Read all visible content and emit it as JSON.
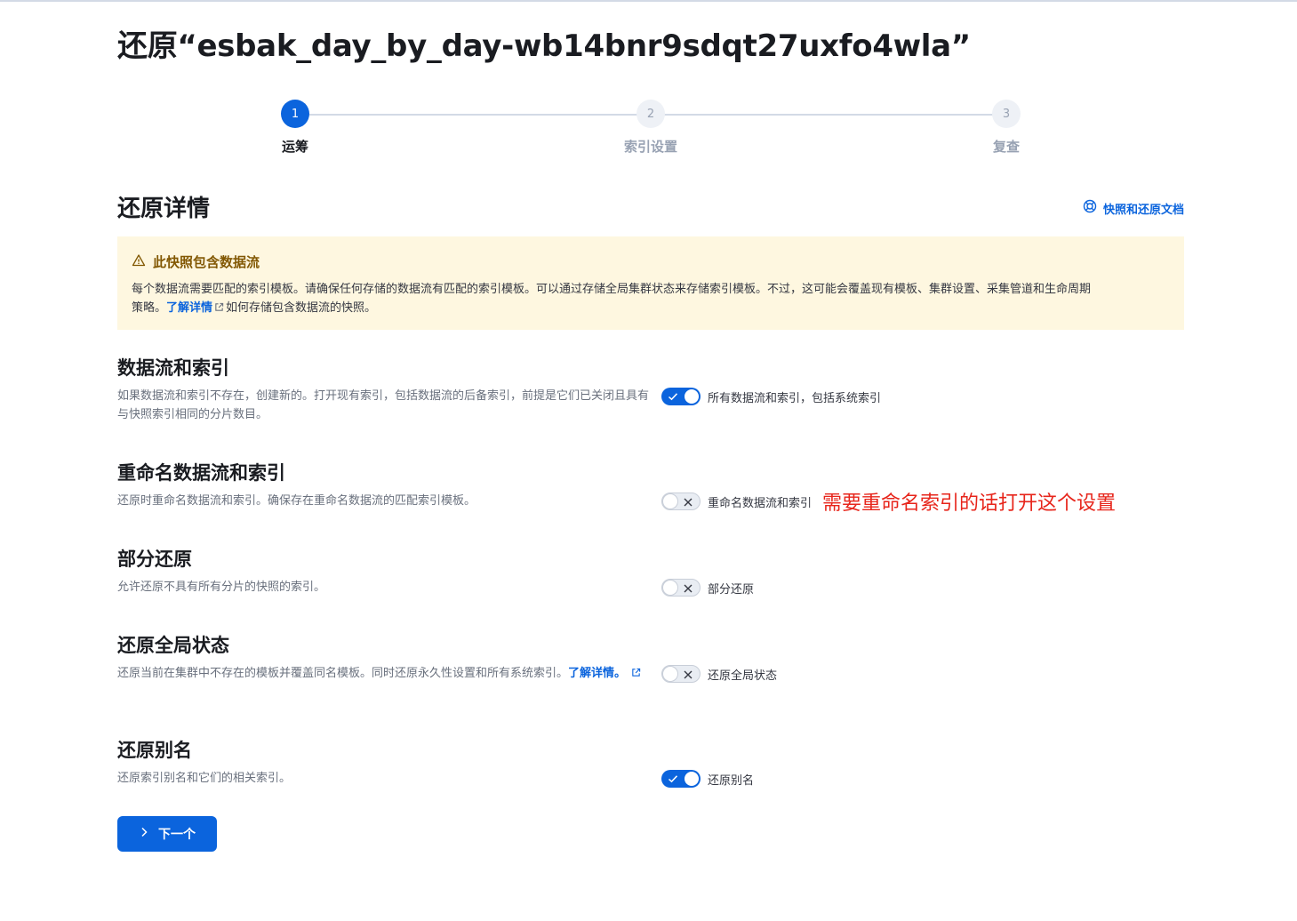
{
  "page": {
    "title": "还原“esbak_day_by_day-wb14bnr9sdqt27uxfo4wla”"
  },
  "stepper": {
    "steps": [
      {
        "number": "1",
        "label": "运筹",
        "state": "active"
      },
      {
        "number": "2",
        "label": "索引设置",
        "state": "inactive"
      },
      {
        "number": "3",
        "label": "复查",
        "state": "inactive"
      }
    ]
  },
  "details": {
    "title": "还原详情",
    "doc_link": "快照和还原文档"
  },
  "callout": {
    "title": "此快照包含数据流",
    "body_line1": "每个数据流需要匹配的索引模板。请确保任何存储的数据流有匹配的索引模板。可以通过存储全局集群状态来存储索引模板。不过，这可能会覆盖现有模板、集群设置、采集管道和生命周期",
    "body_prefix": "策略。",
    "link": "了解详情",
    "body_suffix": "如何存储包含数据流的快照。"
  },
  "settings": {
    "data_streams": {
      "title": "数据流和索引",
      "description": "如果数据流和索引不存在，创建新的。打开现有索引，包括数据流的后备索引，前提是它们已关闭且具有与快照索引相同的分片数目。",
      "toggle_label": "所有数据流和索引，包括系统索引",
      "enabled": true
    },
    "rename": {
      "title": "重命名数据流和索引",
      "description": "还原时重命名数据流和索引。确保存在重命名数据流的匹配索引模板。",
      "toggle_label": "重命名数据流和索引",
      "enabled": false,
      "annotation": "需要重命名索引的话打开这个设置"
    },
    "partial": {
      "title": "部分还原",
      "description": "允许还原不具有所有分片的快照的索引。",
      "toggle_label": "部分还原",
      "enabled": false
    },
    "global_state": {
      "title": "还原全局状态",
      "description": "还原当前在集群中不存在的模板并覆盖同名模板。同时还原永久性设置和所有系统索引。",
      "link": "了解详情。",
      "toggle_label": "还原全局状态",
      "enabled": false
    },
    "aliases": {
      "title": "还原别名",
      "description": "还原索引别名和它们的相关索引。",
      "toggle_label": "还原别名",
      "enabled": true
    }
  },
  "footer": {
    "next_label": "下一个"
  },
  "colors": {
    "primary": "#0b64dd",
    "warning_bg": "#fef7e0",
    "warning_text": "#825803",
    "annotation": "#e7251b"
  }
}
